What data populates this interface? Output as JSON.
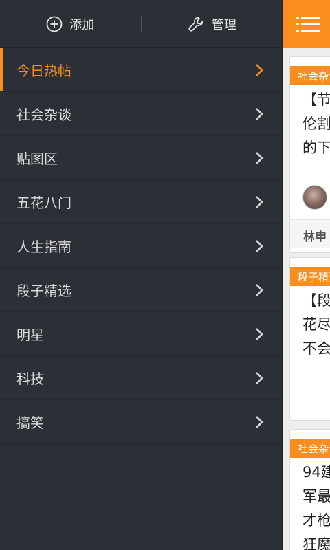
{
  "toolbar": {
    "add_label": "添加",
    "manage_label": "管理"
  },
  "menu": {
    "items": [
      {
        "label": "今日热帖",
        "active": true
      },
      {
        "label": "社会杂谈"
      },
      {
        "label": "贴图区"
      },
      {
        "label": "五花八门"
      },
      {
        "label": "人生指南"
      },
      {
        "label": "段子精选"
      },
      {
        "label": "明星"
      },
      {
        "label": "科技"
      },
      {
        "label": "搞笑"
      }
    ]
  },
  "feed": {
    "cards": [
      {
        "tag": "社会杂谈",
        "lines": [
          "【节",
          "伦割",
          "的下"
        ],
        "author": "林申"
      },
      {
        "tag": "段子精选",
        "lines": [
          "【段",
          "花尽",
          "不会"
        ]
      },
      {
        "tag": "社会杂谈",
        "lines": [
          "94建",
          "军最",
          "才枪",
          "狂魔"
        ]
      }
    ]
  },
  "colors": {
    "accent": "#f98d1d",
    "drawer_bg": "#2b3036",
    "content_bg": "#eeeeee"
  },
  "icons": {
    "add": "plus-circle-icon",
    "manage": "wrench-icon",
    "menu": "hamburger-menu-icon",
    "chevron": "chevron-right-icon"
  }
}
